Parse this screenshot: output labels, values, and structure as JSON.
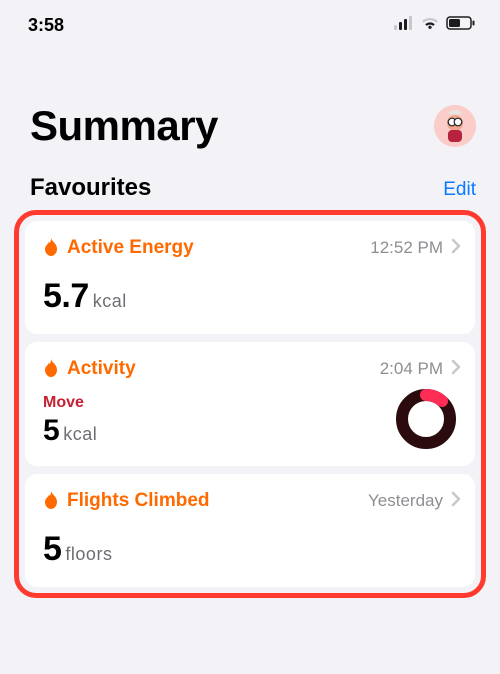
{
  "status": {
    "time": "3:58"
  },
  "header": {
    "title": "Summary"
  },
  "favourites": {
    "section_title": "Favourites",
    "edit_label": "Edit"
  },
  "cards": {
    "active_energy": {
      "title": "Active Energy",
      "time": "12:52 PM",
      "value": "5.7",
      "unit": "kcal"
    },
    "activity": {
      "title": "Activity",
      "time": "2:04 PM",
      "sub_label": "Move",
      "value": "5",
      "unit": "kcal"
    },
    "flights": {
      "title": "Flights Climbed",
      "time": "Yesterday",
      "value": "5",
      "unit": "floors"
    }
  }
}
